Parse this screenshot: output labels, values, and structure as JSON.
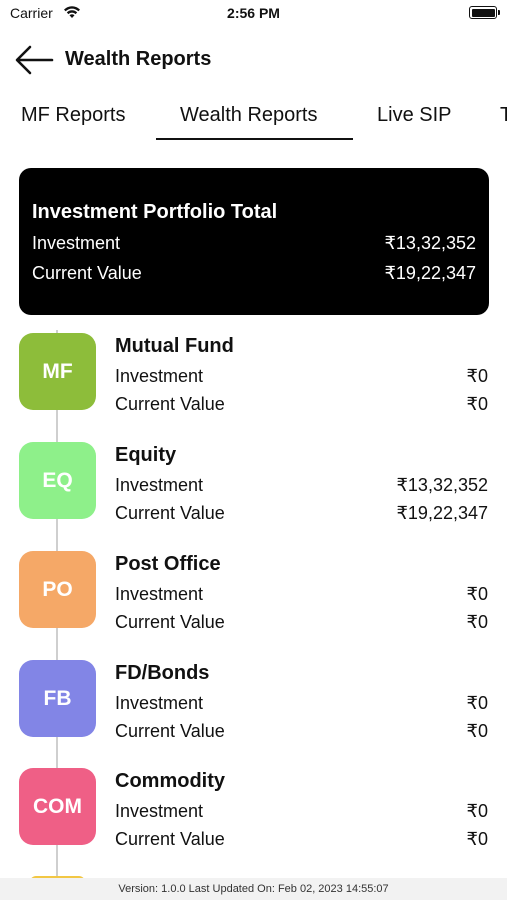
{
  "status_bar": {
    "carrier": "Carrier",
    "time": "2:56 PM"
  },
  "header": {
    "title": "Wealth Reports"
  },
  "tabs": [
    {
      "label": "MF Reports",
      "active": false
    },
    {
      "label": "Wealth Reports",
      "active": true
    },
    {
      "label": "Live SIP",
      "active": false
    },
    {
      "label": "T",
      "active": false
    }
  ],
  "portfolio_total": {
    "title": "Investment Portfolio Total",
    "investment_label": "Investment",
    "investment_value": "₹13,32,352",
    "current_label": "Current Value",
    "current_value": "₹19,22,347"
  },
  "categories": [
    {
      "badge": "MF",
      "name": "Mutual Fund",
      "color": "#8dbd3a",
      "investment_label": "Investment",
      "investment": "₹0",
      "current_label": "Current Value",
      "current": "₹0"
    },
    {
      "badge": "EQ",
      "name": "Equity",
      "color": "#8ef08a",
      "investment_label": "Investment",
      "investment": "₹13,32,352",
      "current_label": "Current Value",
      "current": "₹19,22,347"
    },
    {
      "badge": "PO",
      "name": "Post Office",
      "color": "#f5a867",
      "investment_label": "Investment",
      "investment": "₹0",
      "current_label": "Current Value",
      "current": "₹0"
    },
    {
      "badge": "FB",
      "name": "FD/Bonds",
      "color": "#8285e6",
      "investment_label": "Investment",
      "investment": "₹0",
      "current_label": "Current Value",
      "current": "₹0"
    },
    {
      "badge": "COM",
      "name": "Commodity",
      "color": "#ef5f86",
      "investment_label": "Investment",
      "investment": "₹0",
      "current_label": "Current Value",
      "current": "₹0"
    }
  ],
  "footer": {
    "text": "Version: 1.0.0 Last Updated On: Feb 02, 2023 14:55:07"
  }
}
